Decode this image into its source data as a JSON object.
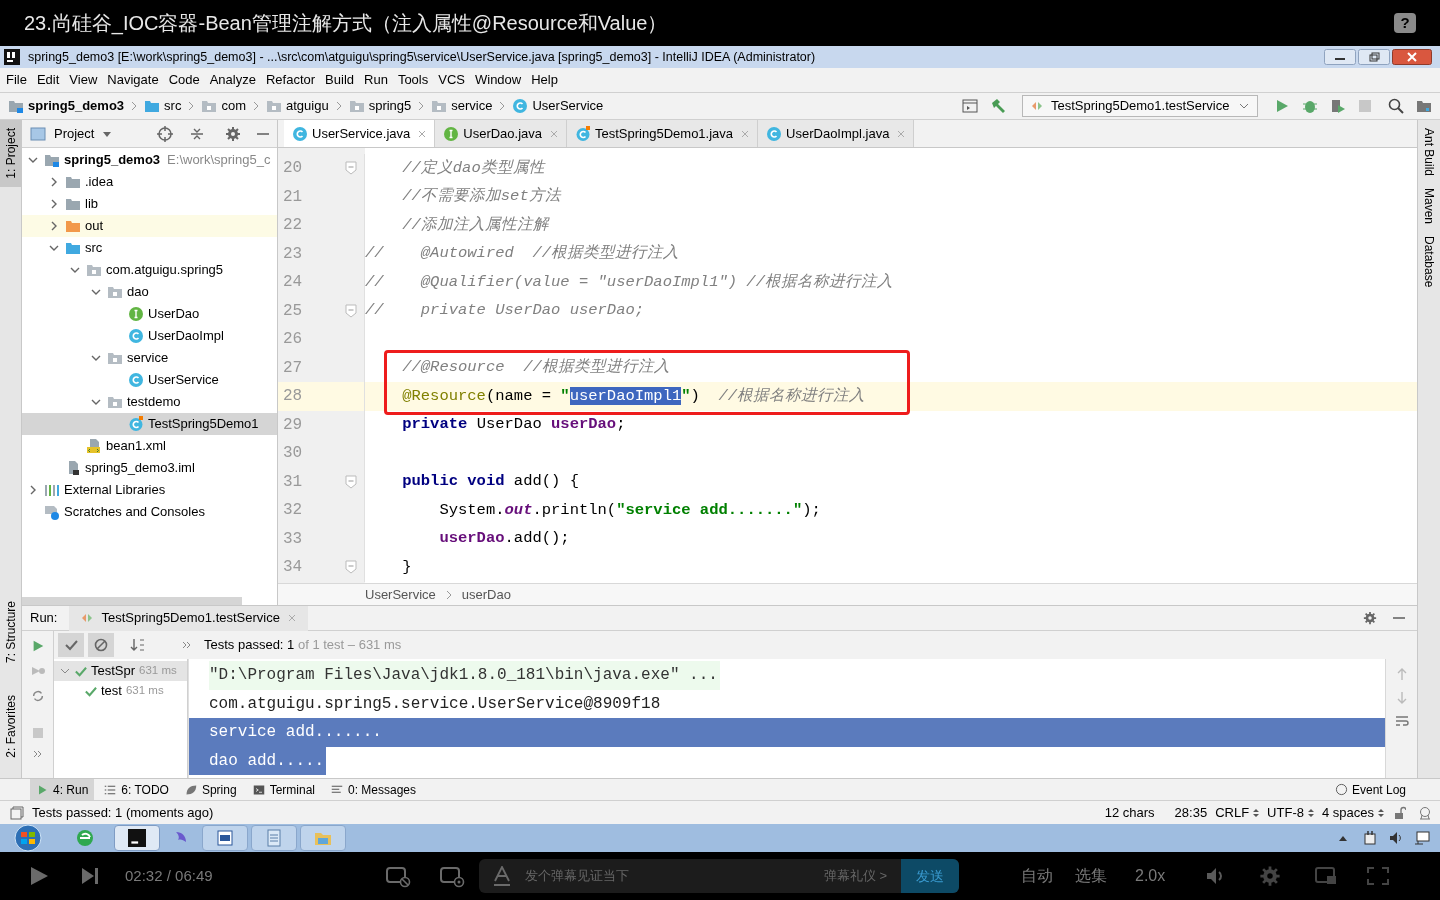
{
  "video_title": "23.尚硅谷_IOC容器-Bean管理注解方式（注入属性@Resource和Value）",
  "help_button": "?",
  "window": {
    "title": "spring5_demo3 [E:\\work\\spring5_demo3] - ...\\src\\com\\atguigu\\spring5\\service\\UserService.java [spring5_demo3] - IntelliJ IDEA (Administrator)"
  },
  "menu": [
    "File",
    "Edit",
    "View",
    "Navigate",
    "Code",
    "Analyze",
    "Refactor",
    "Build",
    "Run",
    "Tools",
    "VCS",
    "Window",
    "Help"
  ],
  "breadcrumbs": [
    {
      "label": "spring5_demo3",
      "kind": "module"
    },
    {
      "label": "src",
      "kind": "source-folder"
    },
    {
      "label": "com",
      "kind": "package"
    },
    {
      "label": "atguigu",
      "kind": "package"
    },
    {
      "label": "spring5",
      "kind": "package"
    },
    {
      "label": "service",
      "kind": "package"
    },
    {
      "label": "UserService",
      "kind": "class"
    }
  ],
  "run_config": "TestSpring5Demo1.testService",
  "left_tool_tabs": [
    {
      "label": "1: Project",
      "selected": true
    },
    {
      "label": "7: Structure",
      "selected": false
    },
    {
      "label": "2: Favorites",
      "selected": false
    }
  ],
  "right_tool_tabs": [
    "Ant Build",
    "Maven",
    "Database"
  ],
  "project_panel": {
    "title": "Project",
    "tree": [
      {
        "label": "spring5_demo3",
        "kind": "module",
        "path": "E:\\work\\spring5_c",
        "expanded": true,
        "selected": false,
        "children": [
          {
            "label": ".idea",
            "kind": "folder",
            "expanded": false,
            "selected": false
          },
          {
            "label": "lib",
            "kind": "folder",
            "expanded": false,
            "selected": false
          },
          {
            "label": "out",
            "kind": "excluded-folder",
            "expanded": false,
            "selected": false
          },
          {
            "label": "src",
            "kind": "source-folder",
            "expanded": true,
            "selected": false,
            "children": [
              {
                "label": "com.atguigu.spring5",
                "kind": "package",
                "expanded": true,
                "selected": false,
                "children": [
                  {
                    "label": "dao",
                    "kind": "package",
                    "expanded": true,
                    "selected": false,
                    "children": [
                      {
                        "label": "UserDao",
                        "kind": "interface",
                        "selected": false
                      },
                      {
                        "label": "UserDaoImpl",
                        "kind": "class",
                        "selected": false
                      }
                    ]
                  },
                  {
                    "label": "service",
                    "kind": "package",
                    "expanded": true,
                    "selected": false,
                    "children": [
                      {
                        "label": "UserService",
                        "kind": "class",
                        "selected": false
                      }
                    ]
                  },
                  {
                    "label": "testdemo",
                    "kind": "package",
                    "expanded": true,
                    "selected": false,
                    "children": [
                      {
                        "label": "TestSpring5Demo1",
                        "kind": "test-class",
                        "selected": true
                      }
                    ]
                  }
                ]
              },
              {
                "label": "bean1.xml",
                "kind": "xml",
                "selected": false
              }
            ]
          },
          {
            "label": "spring5_demo3.iml",
            "kind": "iml",
            "selected": false
          }
        ]
      },
      {
        "label": "External Libraries",
        "kind": "libraries",
        "expanded": false,
        "selected": false
      },
      {
        "label": "Scratches and Consoles",
        "kind": "scratches",
        "selected": false
      }
    ]
  },
  "editor_tabs": [
    {
      "label": "UserService.java",
      "kind": "class",
      "selected": true
    },
    {
      "label": "UserDao.java",
      "kind": "interface",
      "selected": false
    },
    {
      "label": "TestSpring5Demo1.java",
      "kind": "test-class",
      "selected": false
    },
    {
      "label": "UserDaoImpl.java",
      "kind": "class",
      "selected": false
    }
  ],
  "code_lines": [
    {
      "number": "20",
      "fold": true,
      "current": false,
      "boxed": false,
      "tokens": [
        {
          "text": "    //定义dao类型属性",
          "kind": "comment"
        }
      ]
    },
    {
      "number": "21",
      "fold": false,
      "current": false,
      "boxed": false,
      "tokens": [
        {
          "text": "    //不需要添加set方法",
          "kind": "comment"
        }
      ]
    },
    {
      "number": "22",
      "fold": false,
      "current": false,
      "boxed": false,
      "tokens": [
        {
          "text": "    //添加注入属性注解",
          "kind": "comment"
        }
      ]
    },
    {
      "number": "23",
      "fold": false,
      "current": false,
      "boxed": false,
      "tokens": [
        {
          "text": "//    @Autowired  //根据类型进行注入",
          "kind": "comment"
        }
      ]
    },
    {
      "number": "24",
      "fold": false,
      "current": false,
      "boxed": false,
      "tokens": [
        {
          "text": "//    @Qualifier(value = \"userDaoImpl1\") //根据名称进行注入",
          "kind": "comment"
        }
      ]
    },
    {
      "number": "25",
      "fold": true,
      "current": false,
      "boxed": false,
      "tokens": [
        {
          "text": "//    private UserDao userDao;",
          "kind": "comment"
        }
      ]
    },
    {
      "number": "26",
      "fold": false,
      "current": false,
      "boxed": false
    },
    {
      "number": "27",
      "fold": false,
      "current": false,
      "boxed": true,
      "tokens": [
        {
          "text": "    //@Resource  //根据类型进行注入",
          "kind": "comment"
        }
      ]
    },
    {
      "number": "28",
      "fold": false,
      "current": true,
      "boxed": true,
      "tokens": [
        {
          "text": "    @Resource",
          "kind": "annotation"
        },
        {
          "text": "(name = ",
          "kind": "plain"
        },
        {
          "text": "\"",
          "kind": "string"
        },
        {
          "text": "userDaoImpl1",
          "kind": "selected"
        },
        {
          "text": "\"",
          "kind": "string"
        },
        {
          "text": ")",
          "kind": "plain"
        },
        {
          "text": "  //根据名称进行注入",
          "kind": "comment"
        }
      ]
    },
    {
      "number": "29",
      "fold": false,
      "current": false,
      "boxed": false,
      "tokens": [
        {
          "text": "    private",
          "kind": "keyword"
        },
        {
          "text": " UserDao ",
          "kind": "plain"
        },
        {
          "text": "userDao",
          "kind": "field"
        },
        {
          "text": ";",
          "kind": "plain"
        }
      ]
    },
    {
      "number": "30",
      "fold": false,
      "current": false,
      "boxed": false
    },
    {
      "number": "31",
      "fold": true,
      "current": false,
      "boxed": false,
      "tokens": [
        {
          "text": "    public void",
          "kind": "keyword"
        },
        {
          "text": " add() {",
          "kind": "plain"
        }
      ]
    },
    {
      "number": "32",
      "fold": false,
      "current": false,
      "boxed": false,
      "tokens": [
        {
          "text": "        System.",
          "kind": "plain"
        },
        {
          "text": "out",
          "kind": "static"
        },
        {
          "text": ".println(",
          "kind": "plain"
        },
        {
          "text": "\"service add.......\"",
          "kind": "string"
        },
        {
          "text": ");",
          "kind": "plain"
        }
      ]
    },
    {
      "number": "33",
      "fold": false,
      "current": false,
      "boxed": false,
      "tokens": [
        {
          "text": "        userDao",
          "kind": "field"
        },
        {
          "text": ".add();",
          "kind": "plain"
        }
      ]
    },
    {
      "number": "34",
      "fold": true,
      "current": false,
      "boxed": false,
      "tokens": [
        {
          "text": "    }",
          "kind": "plain"
        }
      ]
    }
  ],
  "editor_breadcrumbs": [
    "UserService",
    "userDao"
  ],
  "run_panel": {
    "label": "Run:",
    "tab": "TestSpring5Demo1.testService",
    "status": "Tests passed: 1",
    "status_detail": "of 1 test – 631 ms",
    "tests": [
      {
        "label": "TestSpr",
        "time": "631 ms",
        "expanded": true,
        "selected": true,
        "children": [
          {
            "label": "test",
            "time": "631 ms",
            "selected": false
          }
        ]
      }
    ],
    "console": [
      {
        "text": "\"D:\\Program Files\\Java\\jdk1.8.0_181\\bin\\java.exe\" ...",
        "kind": "command"
      },
      {
        "text": "com.atguigu.spring5.service.UserService@8909f18",
        "kind": "output"
      },
      {
        "text": "service add.......",
        "kind": "selected-line"
      },
      {
        "text": "dao add.....",
        "kind": "selected-text"
      }
    ]
  },
  "tool_tabs": [
    {
      "label": "4: Run",
      "kind": "run",
      "selected": true
    },
    {
      "label": "6: TODO",
      "kind": "list",
      "selected": false
    },
    {
      "label": "Spring",
      "kind": "leaf",
      "selected": false
    },
    {
      "label": "Terminal",
      "kind": "terminal",
      "selected": false
    },
    {
      "label": "0: Messages",
      "kind": "messages",
      "selected": false
    }
  ],
  "event_log": "Event Log",
  "status_bar": {
    "message": "Tests passed: 1 (moments ago)",
    "chars": "12 chars",
    "position": "28:35",
    "line_ending": "CRLF",
    "encoding": "UTF-8",
    "indent": "4 spaces"
  },
  "player": {
    "time": "02:32 / 06:49",
    "danmaku_placeholder": "发个弹幕见证当下",
    "etiquette": "弹幕礼仪 >",
    "send": "发送",
    "auto": "自动",
    "episodes": "选集",
    "speed": "2.0x"
  }
}
